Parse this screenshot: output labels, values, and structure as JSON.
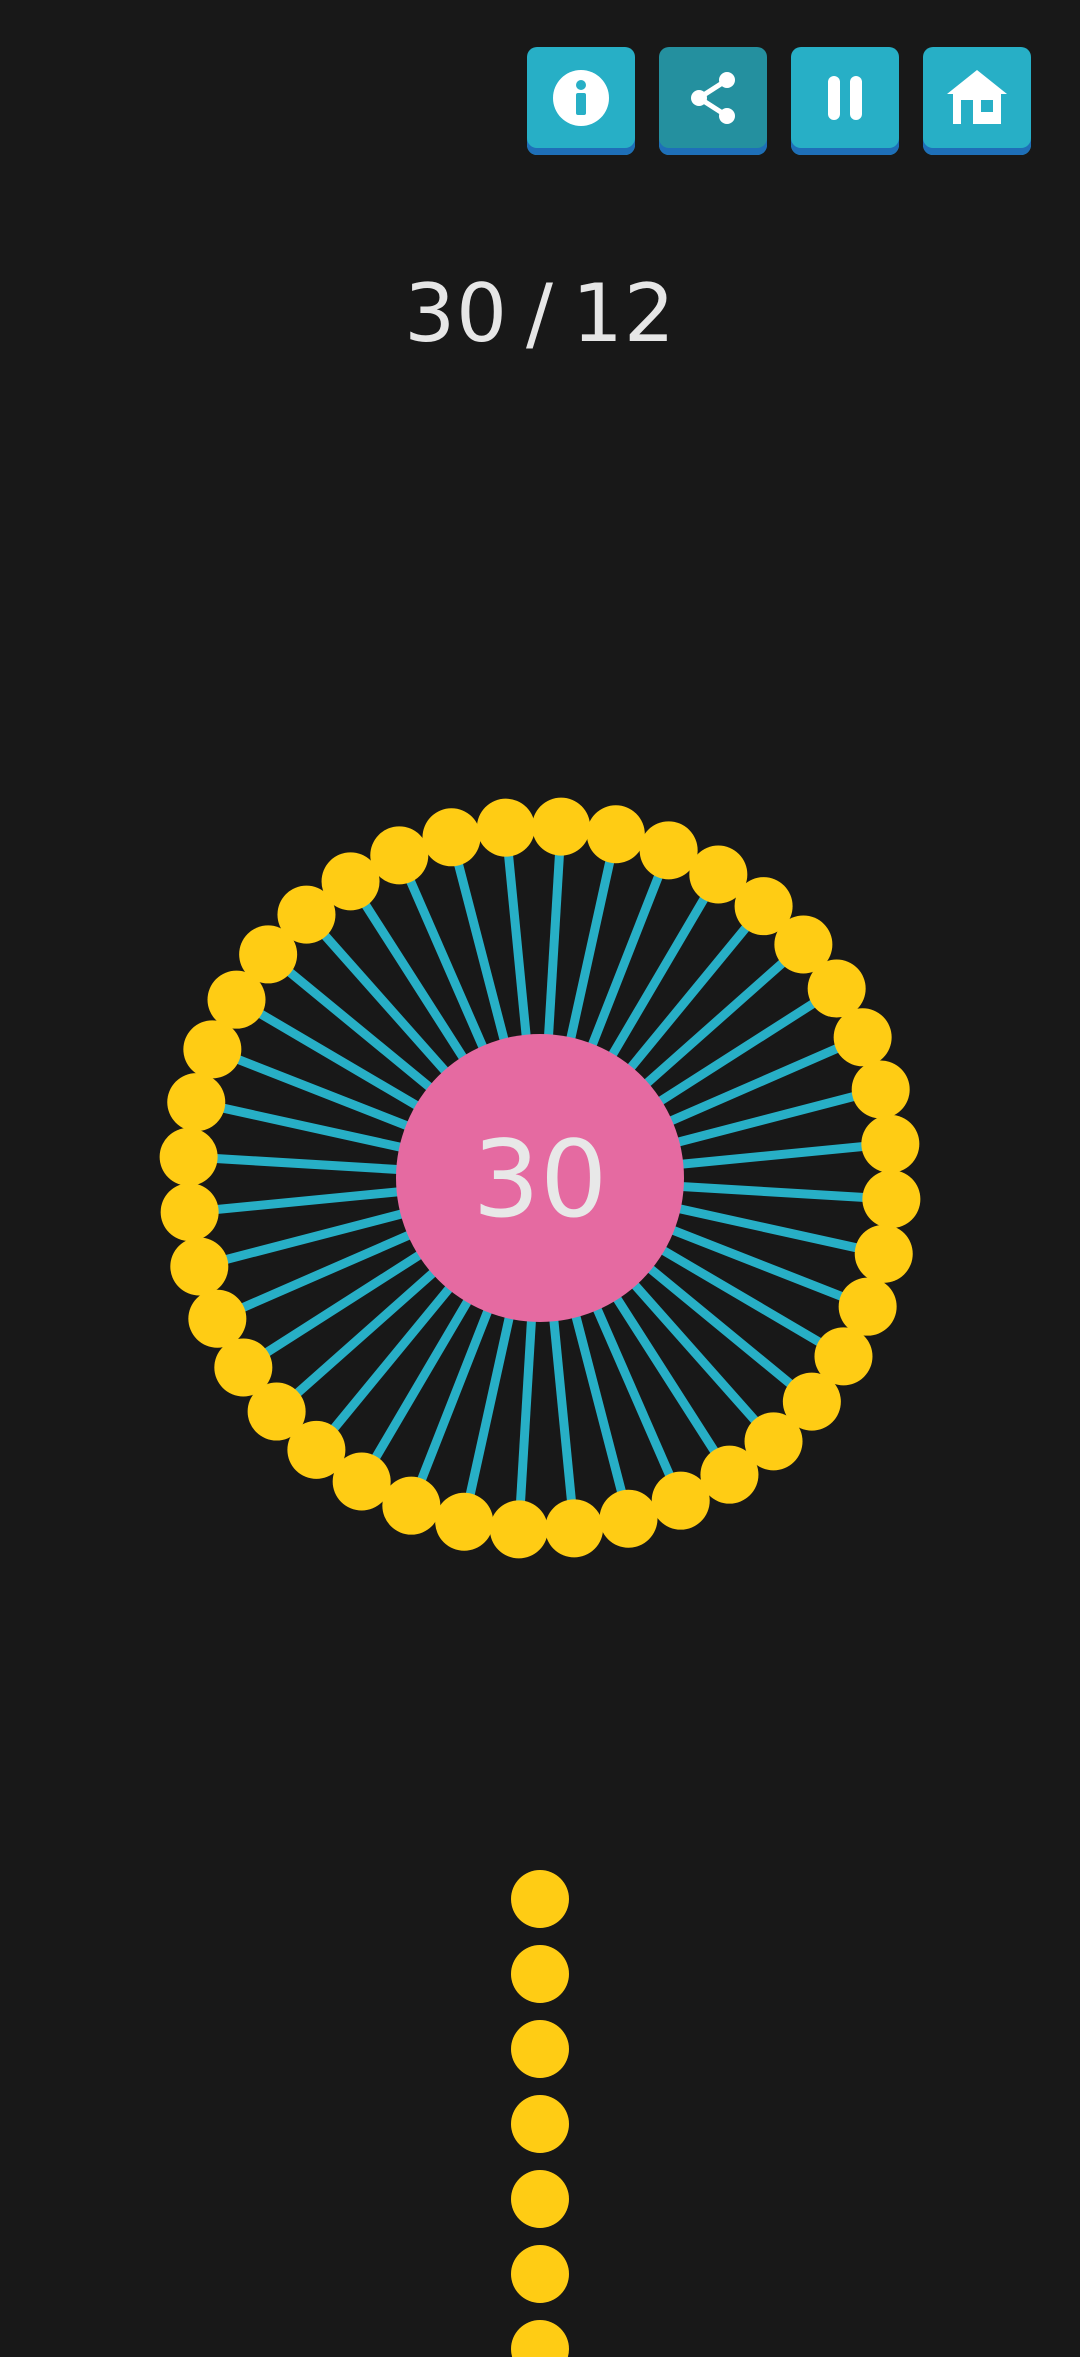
{
  "toolbar": {
    "buttons": [
      {
        "name": "info-button",
        "icon": "info-icon"
      },
      {
        "name": "share-button",
        "icon": "share-icon"
      },
      {
        "name": "pause-button",
        "icon": "pause-icon"
      },
      {
        "name": "home-button",
        "icon": "home-icon"
      }
    ]
  },
  "score": {
    "current": "30",
    "separator": "/",
    "target": "12"
  },
  "hub": {
    "label": "30"
  },
  "pins": {
    "attached_count": 40,
    "queue_count": 7
  },
  "colors": {
    "background": "#181818",
    "button": "#27AFC6",
    "button_dim": "#24909F",
    "button_shadow": "#1E6FB8",
    "hub": "#E56AA1",
    "pin_line": "#27AFC6",
    "pin_ball": "#FFCC14",
    "text": "#E6E6E6"
  }
}
